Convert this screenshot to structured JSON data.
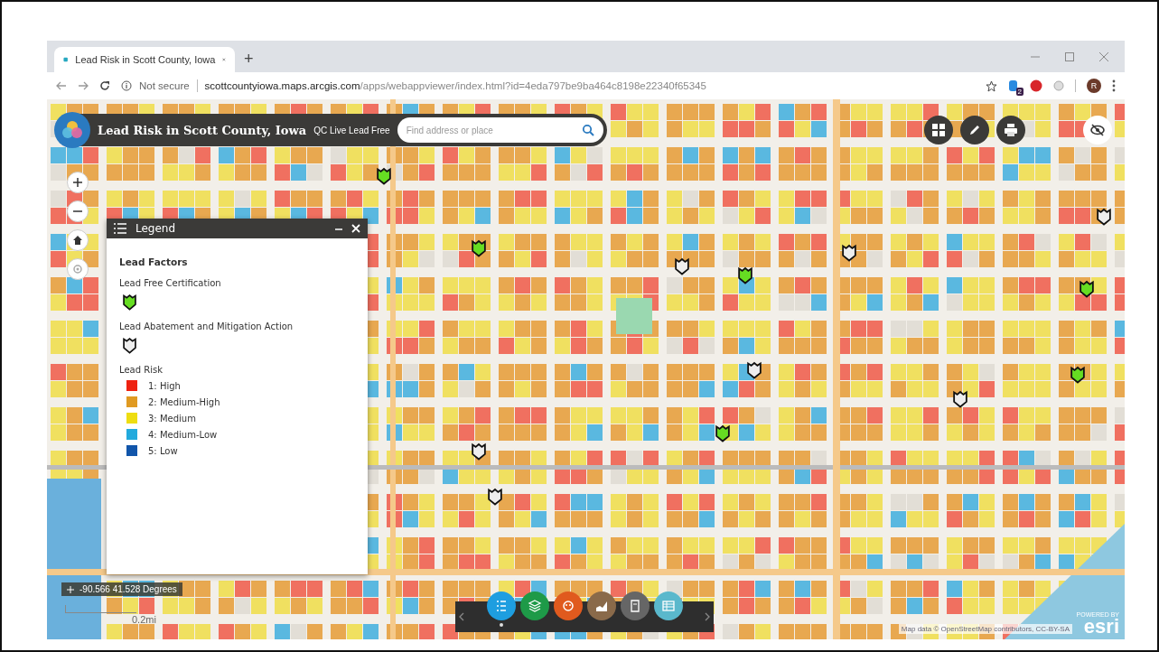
{
  "browser": {
    "tab_title": "Lead Risk in Scott County, Iowa",
    "new_tab": "+",
    "security": "Not secure",
    "url_host": "scottcountyiowa.maps.arcgis.com",
    "url_path": "/apps/webappviewer/index.html?id=4eda797be9ba464c8198e22340f65345",
    "extension_badge": "2",
    "avatar": "R"
  },
  "app": {
    "title": "Lead Risk in Scott County, Iowa",
    "subtitle": "QC Live Lead Free",
    "search": {
      "placeholder": "Find address or place"
    }
  },
  "legend": {
    "title": "Legend",
    "heading": "Lead Factors",
    "layers": [
      {
        "label": "Lead Free Certification",
        "kind": "symbol",
        "color": "#66dd22"
      },
      {
        "label": "Lead Abatement and Mitigation Action",
        "kind": "symbol",
        "color": "#eeeeee"
      },
      {
        "label": "Lead Risk",
        "kind": "classes",
        "classes": [
          {
            "label": "1: High",
            "color": "#ee2211"
          },
          {
            "label": "2: Medium-High",
            "color": "#e09a22"
          },
          {
            "label": "3: Medium",
            "color": "#eedd11"
          },
          {
            "label": "4: Medium-Low",
            "color": "#22aadd"
          },
          {
            "label": "5: Low",
            "color": "#1155aa"
          }
        ]
      }
    ]
  },
  "coordinates": "-90.566 41.528 Degrees",
  "scale": "0.2mi",
  "widgets": [
    {
      "color": "#1e9ee0",
      "selected": true
    },
    {
      "color": "#1e9a48",
      "selected": false
    },
    {
      "color": "#e05a1e",
      "selected": false
    },
    {
      "color": "#8a6a4a",
      "selected": false
    },
    {
      "color": "#666666",
      "selected": false
    },
    {
      "color": "#5ab8cc",
      "selected": false
    }
  ],
  "attribution": "Map data © OpenStreetMap contributors, CC-BY-SA",
  "logo": {
    "powered_by": "POWERED BY",
    "name": "esri"
  }
}
